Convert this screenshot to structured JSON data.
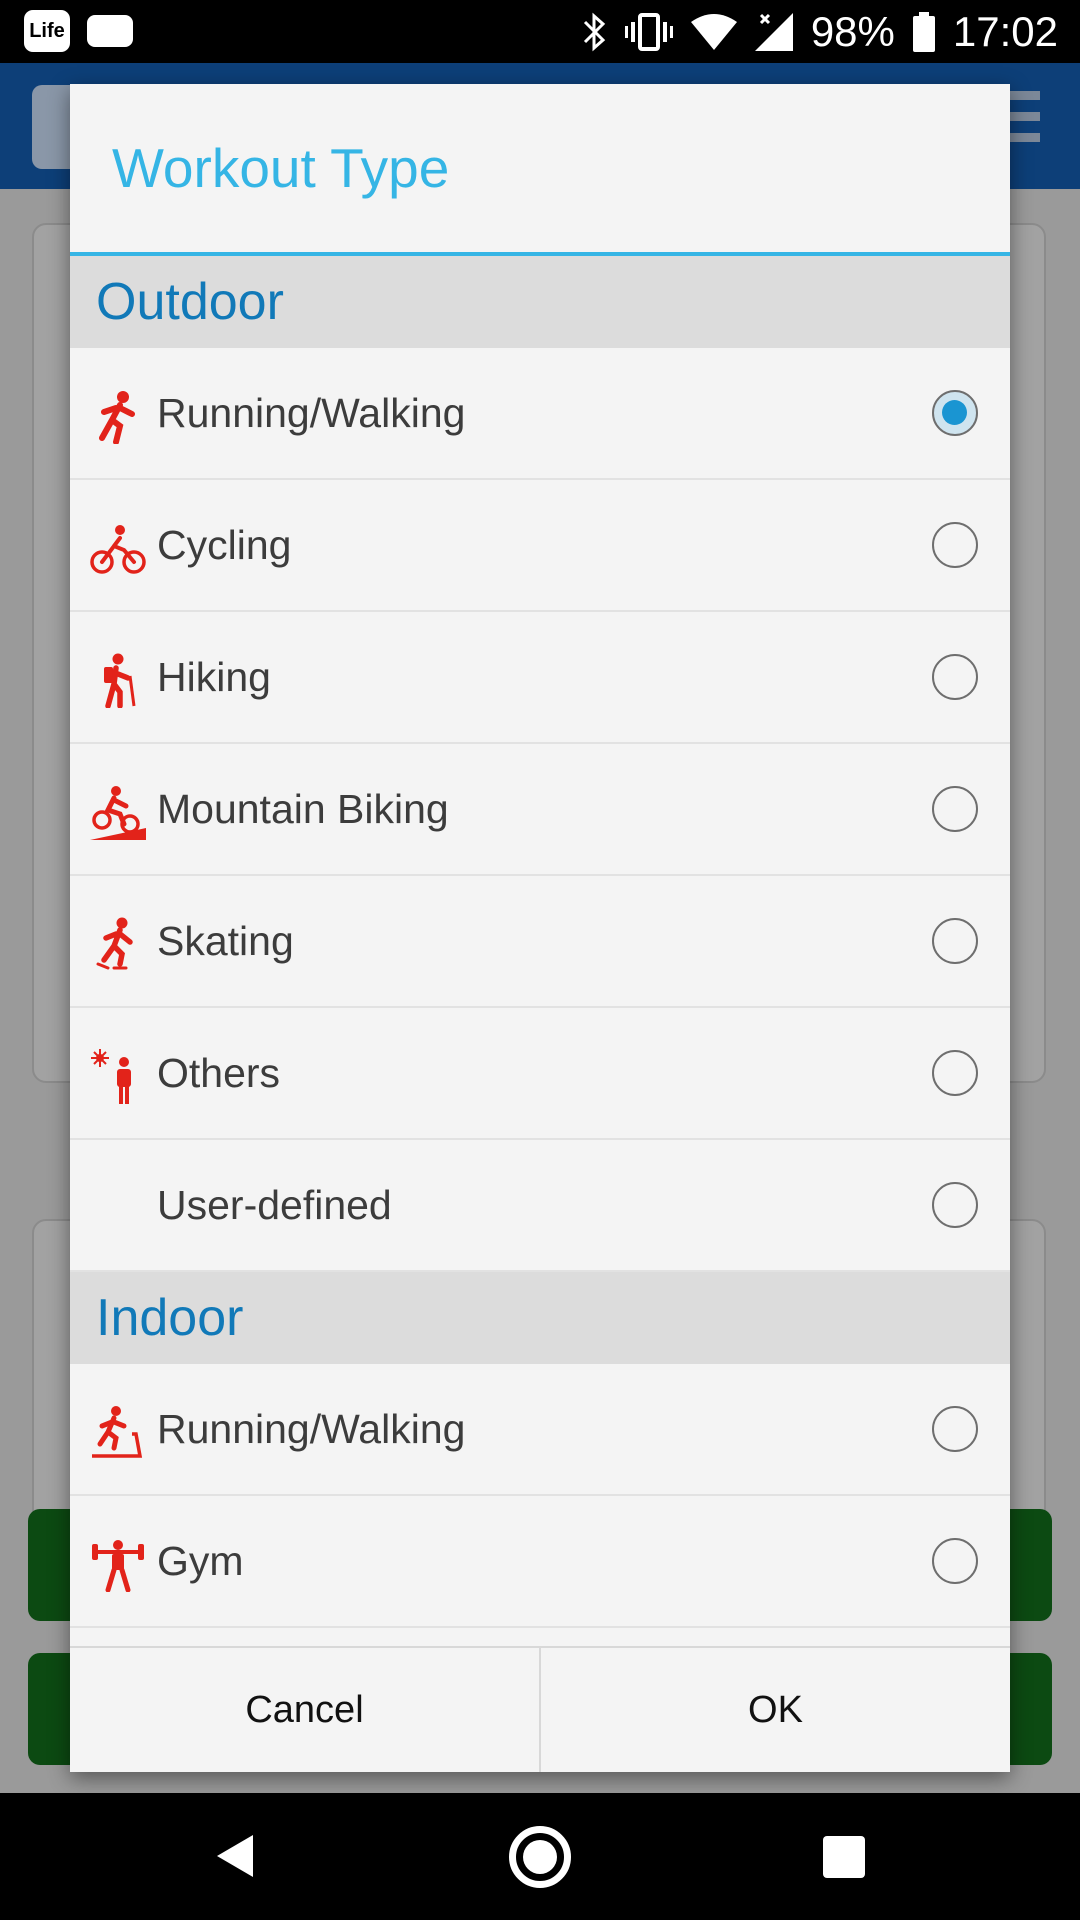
{
  "status_bar": {
    "battery": "98%",
    "time": "17:02",
    "app_icon_text": "Life",
    "icons": [
      "life-app-icon",
      "message-icon",
      "bluetooth-icon",
      "vibrate-icon",
      "wifi-icon",
      "cell-signal-icon",
      "battery-icon"
    ]
  },
  "dialog": {
    "title": "Workout Type",
    "sections": [
      {
        "header": "Outdoor",
        "items": [
          {
            "label": "Running/Walking",
            "icon": "running-icon",
            "selected": true
          },
          {
            "label": "Cycling",
            "icon": "cycling-icon",
            "selected": false
          },
          {
            "label": "Hiking",
            "icon": "hiking-icon",
            "selected": false
          },
          {
            "label": "Mountain Biking",
            "icon": "mountain-biking-icon",
            "selected": false
          },
          {
            "label": "Skating",
            "icon": "skating-icon",
            "selected": false
          },
          {
            "label": "Others",
            "icon": "outdoor-others-icon",
            "selected": false
          },
          {
            "label": "User-defined",
            "icon": "",
            "selected": false
          }
        ]
      },
      {
        "header": "Indoor",
        "items": [
          {
            "label": "Running/Walking",
            "icon": "treadmill-icon",
            "selected": false
          },
          {
            "label": "Gym",
            "icon": "weightlifting-icon",
            "selected": false
          }
        ]
      }
    ],
    "buttons": {
      "cancel": "Cancel",
      "ok": "OK"
    }
  },
  "colors": {
    "accent": "#35b5e5",
    "section_header_text": "#1179b8",
    "icon_red": "#e2231a",
    "radio_checked": "#1a95d2"
  },
  "nav_bar": {
    "icons": [
      "back-icon",
      "home-icon",
      "recents-icon"
    ]
  }
}
